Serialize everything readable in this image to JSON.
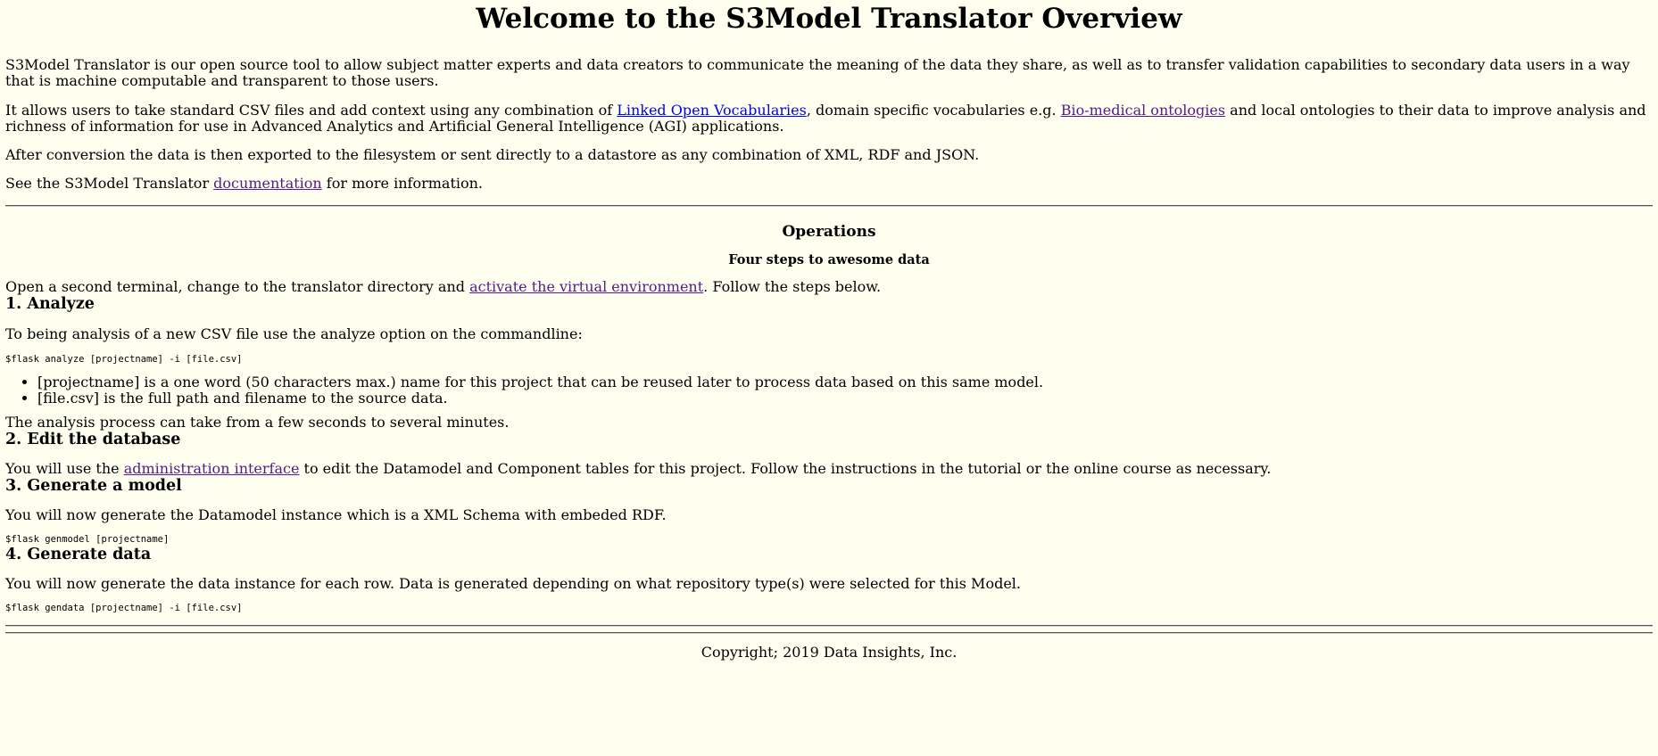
{
  "title": "Welcome to the S3Model Translator Overview",
  "intro": {
    "p1": "S3Model Translator is our open source tool to allow subject matter experts and data creators to communicate the meaning of the data they share, as well as to transfer validation capabilities to secondary data users in a way that is machine computable and transparent to those users.",
    "p2_before": "It allows users to take standard CSV files and add context using any combination of ",
    "p2_link1": "Linked Open Vocabularies",
    "p2_middle": ", domain specific vocabularies e.g. ",
    "p2_link2": "Bio-medical ontologies",
    "p2_after": " and local ontologies to their data to improve analysis and richness of information for use in Advanced Analytics and Artificial General Intelligence (AGI) applications.",
    "p3": "After conversion the data is then exported to the filesystem or sent directly to a datastore as any combination of XML, RDF and JSON.",
    "p4_before": "See the S3Model Translator ",
    "p4_link": "documentation",
    "p4_after": " for more information."
  },
  "operations": {
    "heading": "Operations",
    "subheading": "Four steps to awesome data",
    "intro_before": "Open a second terminal, change to the translator directory and ",
    "intro_link": "activate the virtual environment",
    "intro_after": ". Follow the steps below."
  },
  "steps": {
    "analyze": {
      "heading": "1. Analyze",
      "text": "To being analysis of a new CSV file use the analyze option on the commandline:",
      "command": "$flask analyze [projectname] -i [file.csv]",
      "bullets": [
        "[projectname] is a one word (50 characters max.) name for this project that can be reused later to process data based on this same model.",
        "[file.csv] is the full path and filename to the source data."
      ],
      "note": "The analysis process can take from a few seconds to several minutes."
    },
    "edit": {
      "heading": "2. Edit the database",
      "text_before": "You will use the ",
      "text_link": "administration interface",
      "text_after": " to edit the Datamodel and Component tables for this project. Follow the instructions in the tutorial or the online course as necessary."
    },
    "model": {
      "heading": "3. Generate a model",
      "text": "You will now generate the Datamodel instance which is a XML Schema with embeded RDF.",
      "command": "$flask genmodel [projectname]"
    },
    "data": {
      "heading": "4. Generate data",
      "text": "You will now generate the data instance for each row. Data is generated depending on what repository type(s) were selected for this Model.",
      "command": "$flask gendata [projectname] -i [file.csv]"
    }
  },
  "footer": "Copyright; 2019 Data Insights, Inc.",
  "colors": {
    "background": "#fffff0",
    "link": "#0000ee",
    "visited_link": "#551a8b"
  }
}
